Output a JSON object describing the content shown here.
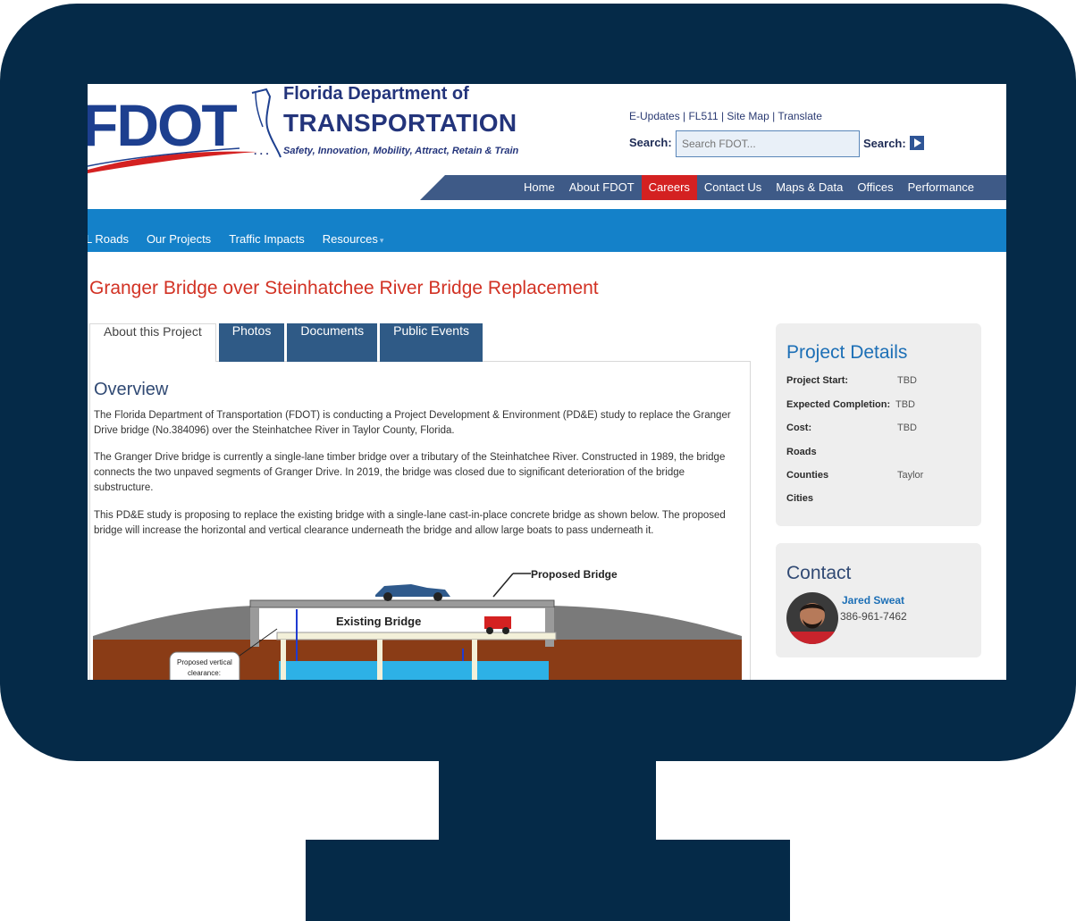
{
  "header": {
    "logo_text": "FDOT",
    "dept_line": "Florida Department of",
    "transport_line": "TRANSPORTATION",
    "tagline": "Safety, Innovation, Mobility, Attract, Retain & Train",
    "tag_dots": ". . .",
    "utility_links": "E-Updates | FL511 | Site Map | Translate",
    "search_label": "Search:",
    "search_placeholder": "Search FDOT...",
    "search_button_label": "Search:"
  },
  "topnav": {
    "items": [
      "Home",
      "About FDOT",
      "Careers",
      "Contact Us",
      "Maps & Data",
      "Offices",
      "Performance"
    ],
    "active": "Careers"
  },
  "subnav": {
    "items": [
      "L Roads",
      "Our Projects",
      "Traffic Impacts",
      "Resources"
    ]
  },
  "page": {
    "title": "Granger Bridge over Steinhatchee River Bridge Replacement"
  },
  "tabs": [
    "About this Project",
    "Photos",
    "Documents",
    "Public Events"
  ],
  "overview": {
    "title": "Overview",
    "paragraphs": [
      "The Florida Department of Transportation (FDOT) is conducting a Project Development & Environment (PD&E) study to replace the Granger Drive bridge (No.384096) over the Steinhatchee River in Taylor County, Florida.",
      "The Granger Drive bridge is currently a single-lane timber bridge over a tributary of the Steinhatchee River. Constructed in 1989, the bridge connects the two unpaved segments of Granger Drive. In 2019, the bridge was closed due to significant deterioration of the bridge substructure.",
      "This PD&E study is proposing to replace the existing bridge with a single-lane cast-in-place concrete bridge as shown below. The proposed bridge will increase the horizontal and vertical clearance underneath the bridge and allow large boats to pass underneath it."
    ]
  },
  "diagram": {
    "proposed_label": "Proposed Bridge",
    "existing_label": "Existing Bridge",
    "callout_line1": "Proposed vertical",
    "callout_line2": "clearance:"
  },
  "project_details": {
    "title": "Project Details",
    "rows": [
      {
        "label": "Project Start:",
        "value": "TBD"
      },
      {
        "label": "Expected Completion:",
        "value": "TBD"
      },
      {
        "label": "Cost:",
        "value": "TBD"
      },
      {
        "label": "Roads",
        "value": ""
      },
      {
        "label": "Counties",
        "value": "Taylor"
      },
      {
        "label": "Cities",
        "value": ""
      }
    ]
  },
  "contact": {
    "title": "Contact",
    "name": "Jared Sweat",
    "phone": "386-961-7462"
  },
  "colors": {
    "monitor": "#052a48",
    "nav_blue": "#3e5a87",
    "active_red": "#d42121",
    "subnav_blue": "#1481c9",
    "title_red": "#d23224"
  }
}
